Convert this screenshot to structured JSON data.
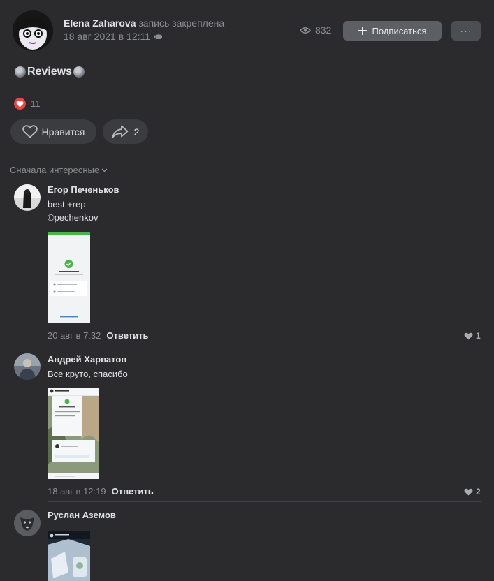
{
  "post": {
    "author": "Elena Zaharova",
    "pinned_note": "запись закреплена",
    "date": "18 авг 2021 в 12:11",
    "views": "832",
    "subscribe_label": "Подписаться",
    "more_label": "···",
    "text": "Reviews",
    "reactions_count": "11",
    "like_label": "Нравится",
    "share_count": "2"
  },
  "comments_sort": "Сначала интересные",
  "comments": [
    {
      "author": "Егор Печеньков",
      "text_line1": "best +rep",
      "text_line2": "©pechenkov",
      "date": "20 авг в 7:32",
      "reply_label": "Ответить",
      "likes": "1"
    },
    {
      "author": "Андрей Харватов",
      "text_line1": "Все круто, спасибо",
      "date": "18 авг в 12:19",
      "reply_label": "Ответить",
      "likes": "2"
    },
    {
      "author": "Руслан Аземов"
    }
  ],
  "colors": {
    "background": "#2b2b2d",
    "button": "#5c5f63",
    "reaction": "#e64646"
  },
  "icons": [
    "android-icon",
    "eye-icon",
    "plus-icon",
    "heart-icon",
    "share-icon",
    "chevron-down-icon"
  ]
}
